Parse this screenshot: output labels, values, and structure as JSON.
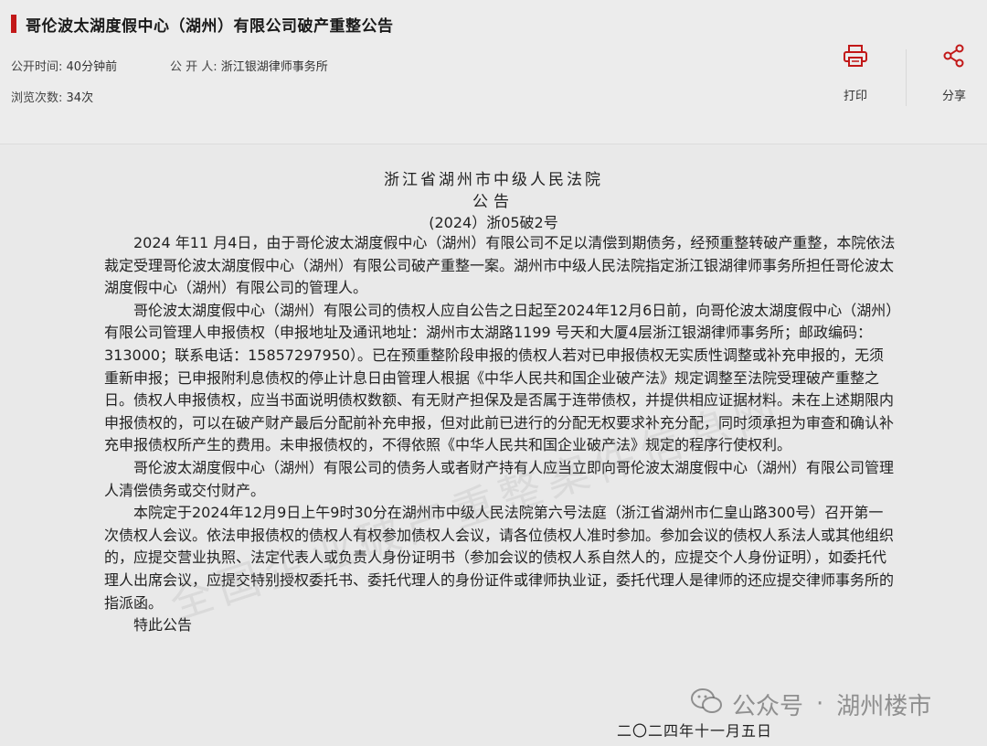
{
  "header": {
    "title": "哥伦波太湖度假中心（湖州）有限公司破产重整公告",
    "publish_time_label": "公开时间:",
    "publish_time_value": "40分钟前",
    "publisher_label": "公 开 人:",
    "publisher_value": "浙江银湖律师事务所",
    "views_label": "浏览次数:",
    "views_value": "34次",
    "print_label": "打印",
    "share_label": "分享",
    "accent_color": "#c21818"
  },
  "document": {
    "court": "浙江省湖州市中级人民法院",
    "notice_word": "公告",
    "case_no": "(2024）浙05破2号",
    "paragraphs": [
      "2024 年11 月4日，由于哥伦波太湖度假中心（湖州）有限公司不足以清偿到期债务，经预重整转破产重整，本院依法裁定受理哥伦波太湖度假中心（湖州）有限公司破产重整一案。湖州市中级人民法院指定浙江银湖律师事务所担任哥伦波太湖度假中心（湖州）有限公司的管理人。",
      "哥伦波太湖度假中心（湖州）有限公司的债权人应自公告之日起至2024年12月6日前，向哥伦波太湖度假中心（湖州）有限公司管理人申报债权（申报地址及通讯地址：湖州市太湖路1199 号天和大厦4层浙江银湖律师事务所；邮政编码：313000；联系电话：15857297950）。已在预重整阶段申报的债权人若对已申报债权无实质性调整或补充申报的，无须重新申报；已申报附利息债权的停止计息日由管理人根据《中华人民共和国企业破产法》规定调整至法院受理破产重整之日。债权人申报债权，应当书面说明债权数额、有无财产担保及是否属于连带债权，并提供相应证据材料。未在上述期限内申报债权的，可以在破产财产最后分配前补充申报，但对此前已进行的分配无权要求补充分配，同时须承担为审查和确认补充申报债权所产生的费用。未申报债权的，不得依照《中华人民共和国企业破产法》规定的程序行使权利。",
      "哥伦波太湖度假中心（湖州）有限公司的债务人或者财产持有人应当立即向哥伦波太湖度假中心（湖州）有限公司管理人清偿债务或交付财产。",
      "本院定于2024年12月9日上午9时30分在湖州市中级人民法院第六号法庭（浙江省湖州市仁皇山路300号）召开第一次债权人会议。依法申报债权的债权人有权参加债权人会议，请各位债权人准时参加。参加会议的债权人系法人或其他组织的，应提交营业执照、法定代表人或负责人身份证明书（参加会议的债权人系自然人的，应提交个人身份证明），如委托代理人出席会议，应提交特别授权委托书、委托代理人的身份证件或律师执业证，委托代理人是律师的还应提交律师事务所的指派函。",
      "特此公告"
    ],
    "date": "二〇二四年十一月五日"
  },
  "watermark": {
    "diagonal": "全国企业破产重整案件信息网",
    "account_label": "公众号",
    "account_name": "湖州楼市",
    "separator": "·"
  }
}
